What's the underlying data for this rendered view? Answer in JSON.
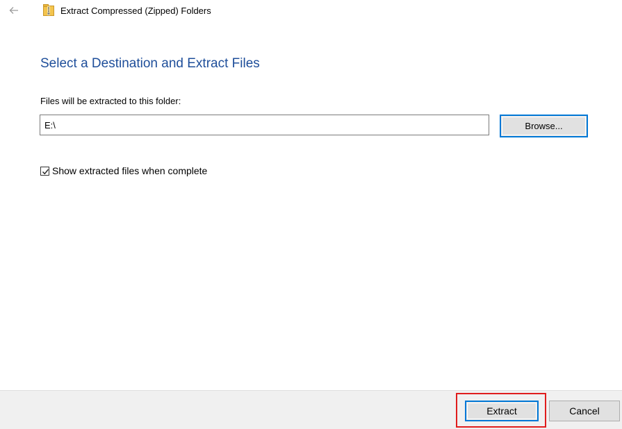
{
  "header": {
    "back_icon": "back-arrow-icon",
    "folder_icon": "zip-folder-icon",
    "title": "Extract Compressed (Zipped) Folders"
  },
  "main": {
    "heading": "Select a Destination and Extract Files",
    "field_label": "Files will be extracted to this folder:",
    "path_value": "E:\\",
    "browse_label": "Browse...",
    "checkbox": {
      "label": "Show extracted files when complete",
      "checked": true
    }
  },
  "footer": {
    "extract_label": "Extract",
    "cancel_label": "Cancel"
  },
  "colors": {
    "heading": "#1e4e9a",
    "focus_border": "#0078d7",
    "highlight": "#e01c1c",
    "footer_bg": "#f0f0f0"
  }
}
